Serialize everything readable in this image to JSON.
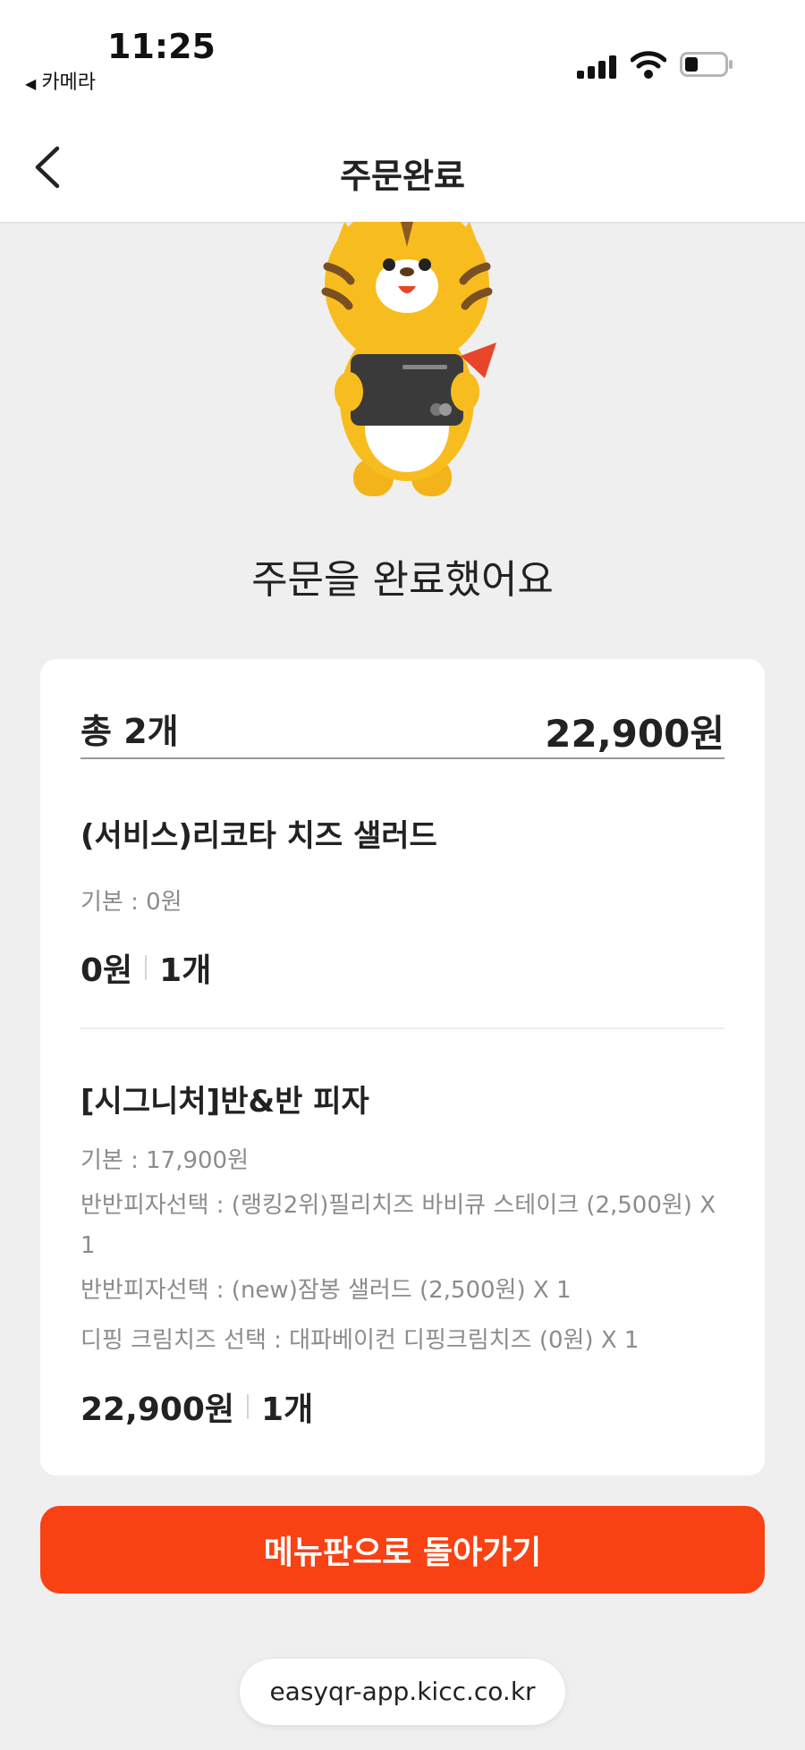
{
  "status_bar": {
    "time": "11:25",
    "back_app": "카메라"
  },
  "header": {
    "title": "주문완료"
  },
  "message": "주문을 완료했어요",
  "summary": {
    "count": "총 2개",
    "total": "22,900원"
  },
  "items": [
    {
      "name": "(서비스)리코타 치즈 샐러드",
      "options": [
        "기본 : 0원"
      ],
      "price": "0원",
      "quantity": "1개"
    },
    {
      "name": "[시그니처]반&반 피자",
      "options": [
        "기본 : 17,900원",
        "반반피자선택 : (랭킹2위)필리치즈 바비큐 스테이크 (2,500원) X",
        "1",
        "반반피자선택 : (new)잠봉 샐러드 (2,500원) X 1",
        "디핑 크림치즈 선택 : 대파베이컨 디핑크림치즈 (0원) X 1"
      ],
      "price": "22,900원",
      "quantity": "1개"
    }
  ],
  "back_to_menu_button": "메뉴판으로 돌아가기",
  "url": "easyqr-app.kicc.co.kr",
  "colors": {
    "accent": "#f94214",
    "background": "#efefef",
    "card": "#ffffff"
  }
}
